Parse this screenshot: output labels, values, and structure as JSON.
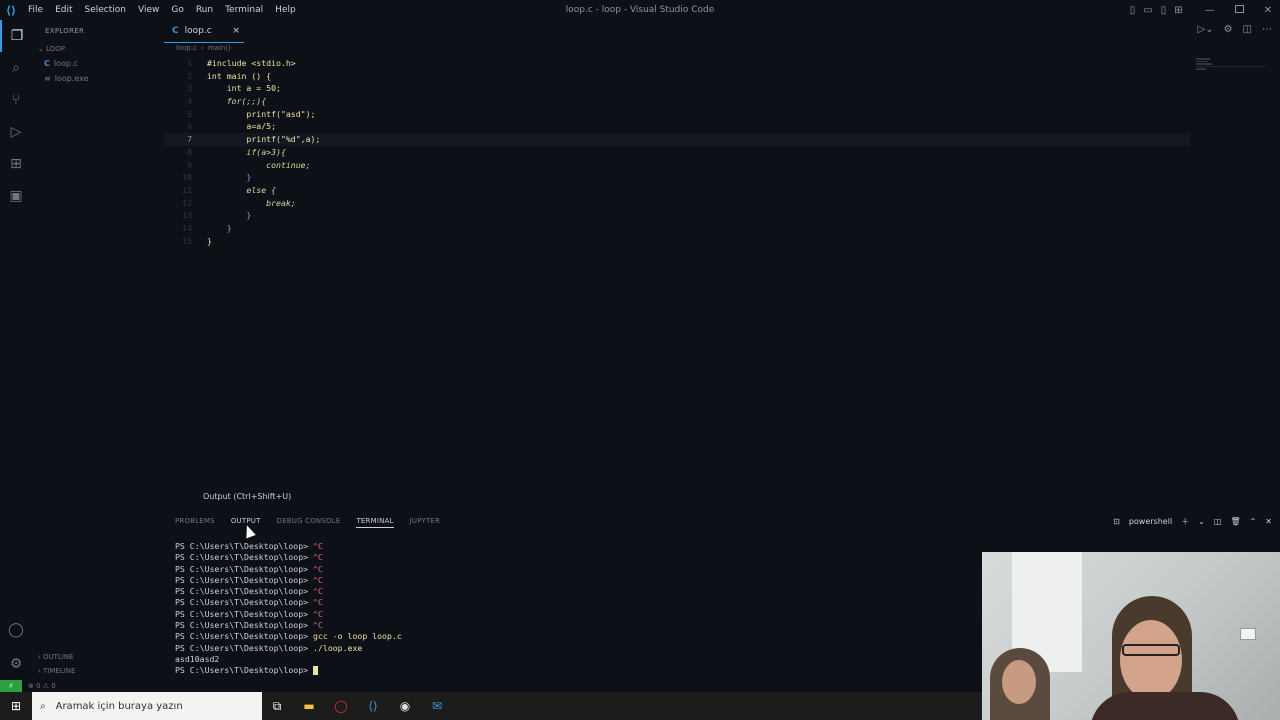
{
  "titlebar": {
    "menu": [
      "File",
      "Edit",
      "Selection",
      "View",
      "Go",
      "Run",
      "Terminal",
      "Help"
    ],
    "title": "loop.c - loop - Visual Studio Code"
  },
  "sidebar": {
    "header": "EXPLORER",
    "folder": "LOOP",
    "files": [
      {
        "icon": "C",
        "name": "loop.c"
      },
      {
        "icon": "≡",
        "name": "loop.exe"
      }
    ],
    "outline": "OUTLINE",
    "timeline": "TIMELINE"
  },
  "tab": {
    "icon": "C",
    "label": "loop.c",
    "close": "×"
  },
  "breadcrumb": {
    "file": "loop.c",
    "sep": "›",
    "symbol": "main()"
  },
  "code": {
    "line_numbers": [
      "1",
      "2",
      "3",
      "4",
      "5",
      "6",
      "7",
      "8",
      "9",
      "10",
      "11",
      "12",
      "13",
      "14",
      "15"
    ],
    "current_line": 7,
    "lines": [
      "#include <stdio.h>",
      "int main () {",
      "    int a = 50;",
      "    for(;;){",
      "        printf(\"asd\");",
      "        a=a/5;",
      "        printf(\"%d\",a);",
      "        if(a>3){",
      "            continue;",
      "        }",
      "        else {",
      "            break;",
      "        }",
      "    }",
      "}"
    ]
  },
  "tooltip": "Output (Ctrl+Shift+U)",
  "panel": {
    "tabs": [
      "PROBLEMS",
      "OUTPUT",
      "DEBUG CONSOLE",
      "TERMINAL",
      "JUPYTER"
    ],
    "selected_tab": "TERMINAL",
    "shell": "powershell",
    "terminal": {
      "prompt": "PS C:\\Users\\T\\Desktop\\loop>",
      "ctrlc": "^C",
      "cmd1": "gcc -o loop loop.c",
      "cmd2": "./loop.exe",
      "output": "asd10asd2"
    }
  },
  "status": {
    "remote": "⚡",
    "errors": "⊗ 0 ⚠ 0"
  },
  "taskbar": {
    "search_placeholder": "Aramak için buraya yazın"
  }
}
